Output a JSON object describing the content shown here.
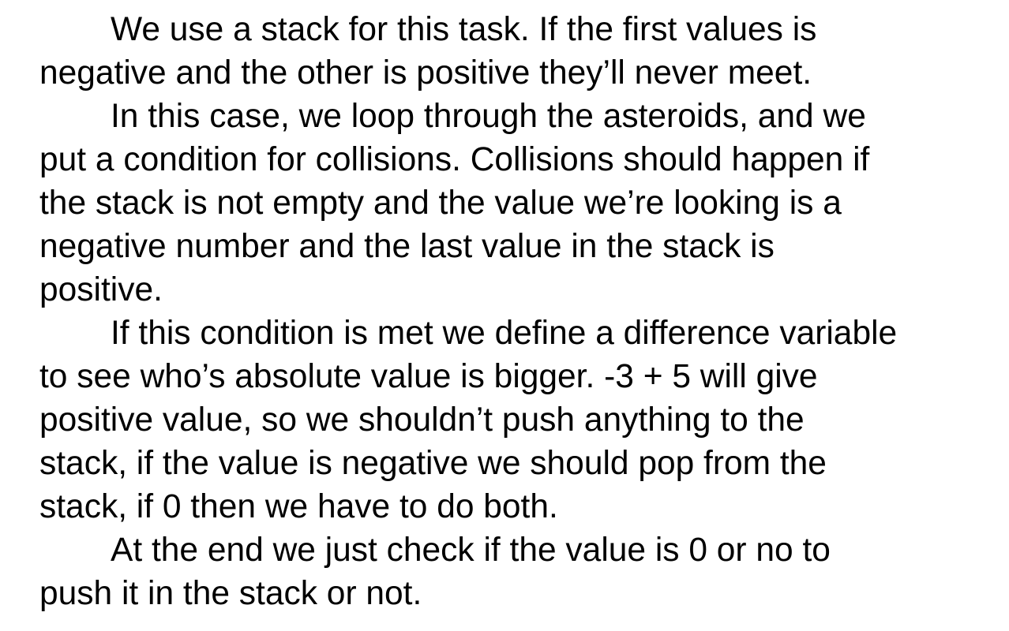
{
  "document": {
    "paragraphs": [
      {
        "lines": [
          "We use a stack for this task. If the first values is",
          "negative and the other is positive they’ll never meet."
        ]
      },
      {
        "lines": [
          "In this case, we loop through the asteroids, and we",
          "put a condition for collisions. Collisions should happen if",
          "the stack is not empty and the value we’re looking is a",
          "negative number and the last value in the stack is",
          "positive."
        ]
      },
      {
        "lines": [
          "If this condition is met we define a difference variable",
          "to see who’s absolute value is bigger. -3 + 5 will give",
          "positive value, so we shouldn’t push anything to the",
          "stack, if the value is negative we should pop from the",
          "stack, if 0 then we have to do both."
        ]
      },
      {
        "lines": [
          "At the end we just check if the value is 0 or no to",
          "push it in the stack or not."
        ]
      }
    ]
  }
}
